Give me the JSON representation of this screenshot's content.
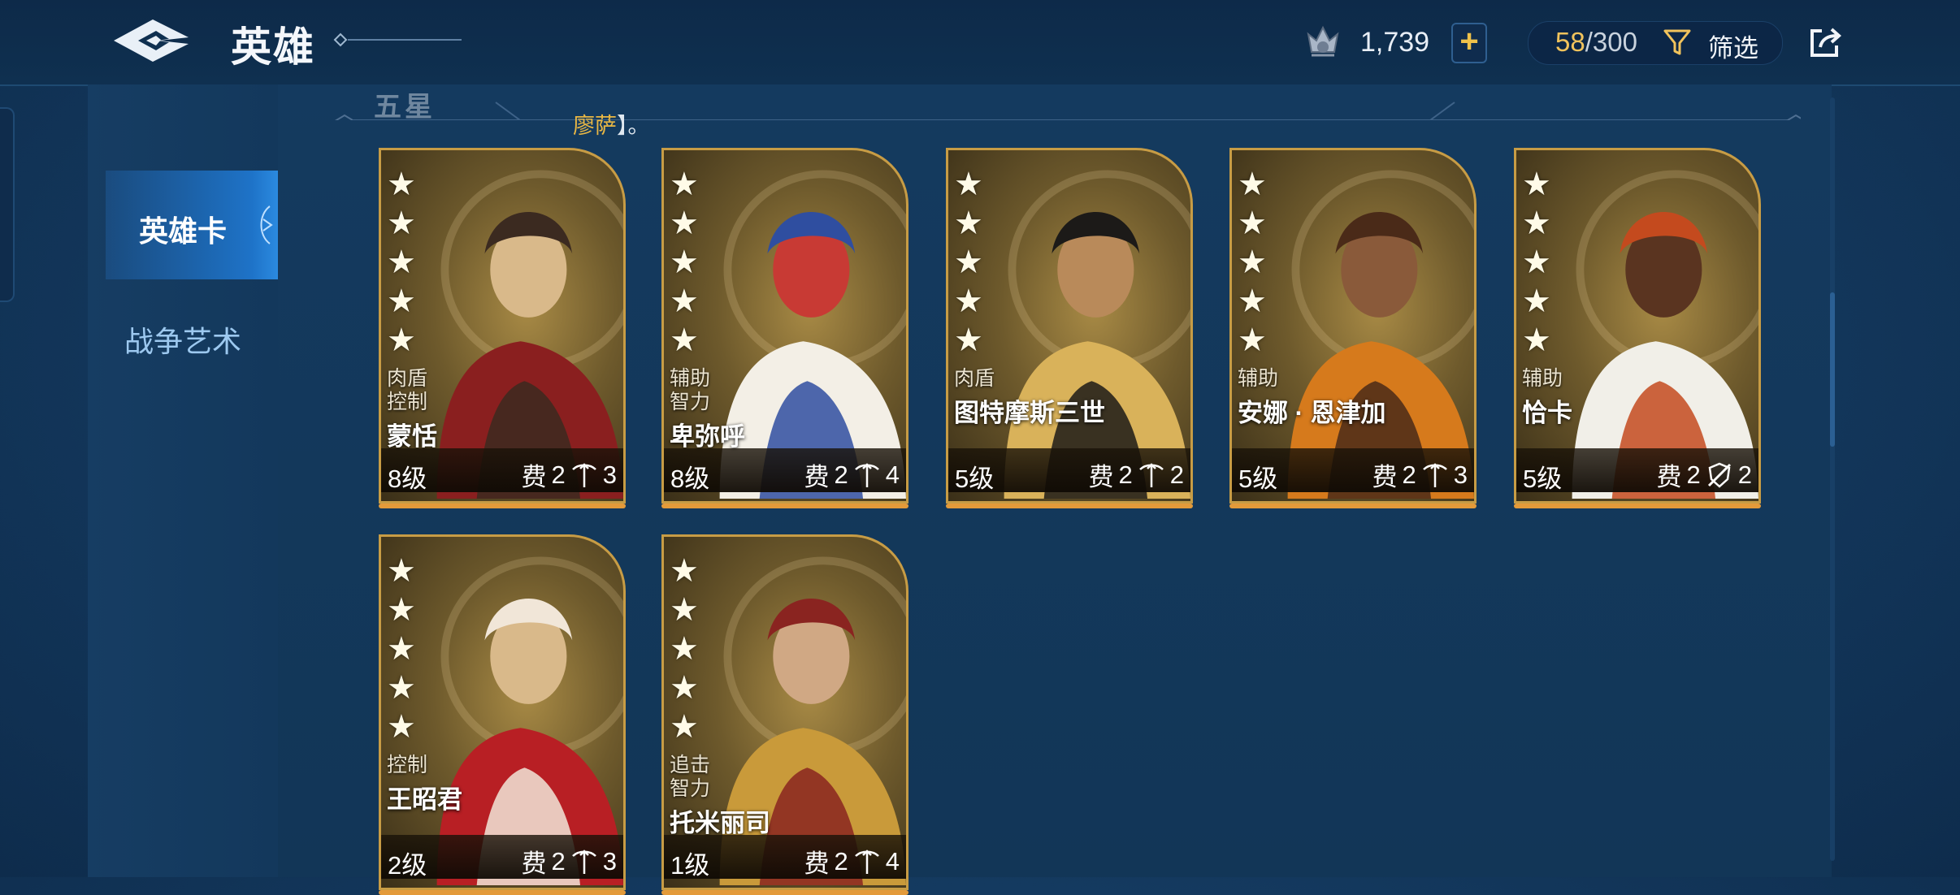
{
  "header": {
    "title": "英雄",
    "currency_amount": "1,739",
    "capacity_current": "58",
    "capacity_total": "/300",
    "filter_label": "筛选"
  },
  "sidebar": {
    "tabs": [
      {
        "label": "英雄卡",
        "active": true
      },
      {
        "label": "战争艺术",
        "active": false
      }
    ]
  },
  "section": {
    "title": "五星",
    "notice": "廖萨",
    "notice_suffix": "】。"
  },
  "heroes": [
    {
      "name": "蒙恬",
      "roles": [
        "肉盾",
        "控制"
      ],
      "level": "8级",
      "cost_label": "费",
      "cost": "2",
      "weapon_icon": "crossbow-icon",
      "weapon_value": "3",
      "stars": 5
    },
    {
      "name": "卑弥呼",
      "roles": [
        "辅助",
        "智力"
      ],
      "level": "8级",
      "cost_label": "费",
      "cost": "2",
      "weapon_icon": "crossbow-icon",
      "weapon_value": "4",
      "stars": 5
    },
    {
      "name": "图特摩斯三世",
      "roles": [
        "肉盾"
      ],
      "level": "5级",
      "cost_label": "费",
      "cost": "2",
      "weapon_icon": "crossbow-icon",
      "weapon_value": "2",
      "stars": 5
    },
    {
      "name": "安娜 · 恩津加",
      "roles": [
        "辅助"
      ],
      "level": "5级",
      "cost_label": "费",
      "cost": "2",
      "weapon_icon": "crossbow-icon",
      "weapon_value": "3",
      "stars": 5
    },
    {
      "name": "恰卡",
      "roles": [
        "辅助"
      ],
      "level": "5级",
      "cost_label": "费",
      "cost": "2",
      "weapon_icon": "no-shield-icon",
      "weapon_value": "2",
      "stars": 5
    },
    {
      "name": "王昭君",
      "roles": [
        "控制"
      ],
      "level": "2级",
      "cost_label": "费",
      "cost": "2",
      "weapon_icon": "crossbow-icon",
      "weapon_value": "3",
      "stars": 5
    },
    {
      "name": "托米丽司",
      "roles": [
        "追击",
        "智力"
      ],
      "level": "1级",
      "cost_label": "费",
      "cost": "2",
      "weapon_icon": "crossbow-icon",
      "weapon_value": "4",
      "stars": 5
    }
  ],
  "colors": {
    "accent_gold": "#f1c35c",
    "active_tab": "#1e73c8",
    "card_border": "#c79c45",
    "background": "#143a60"
  }
}
